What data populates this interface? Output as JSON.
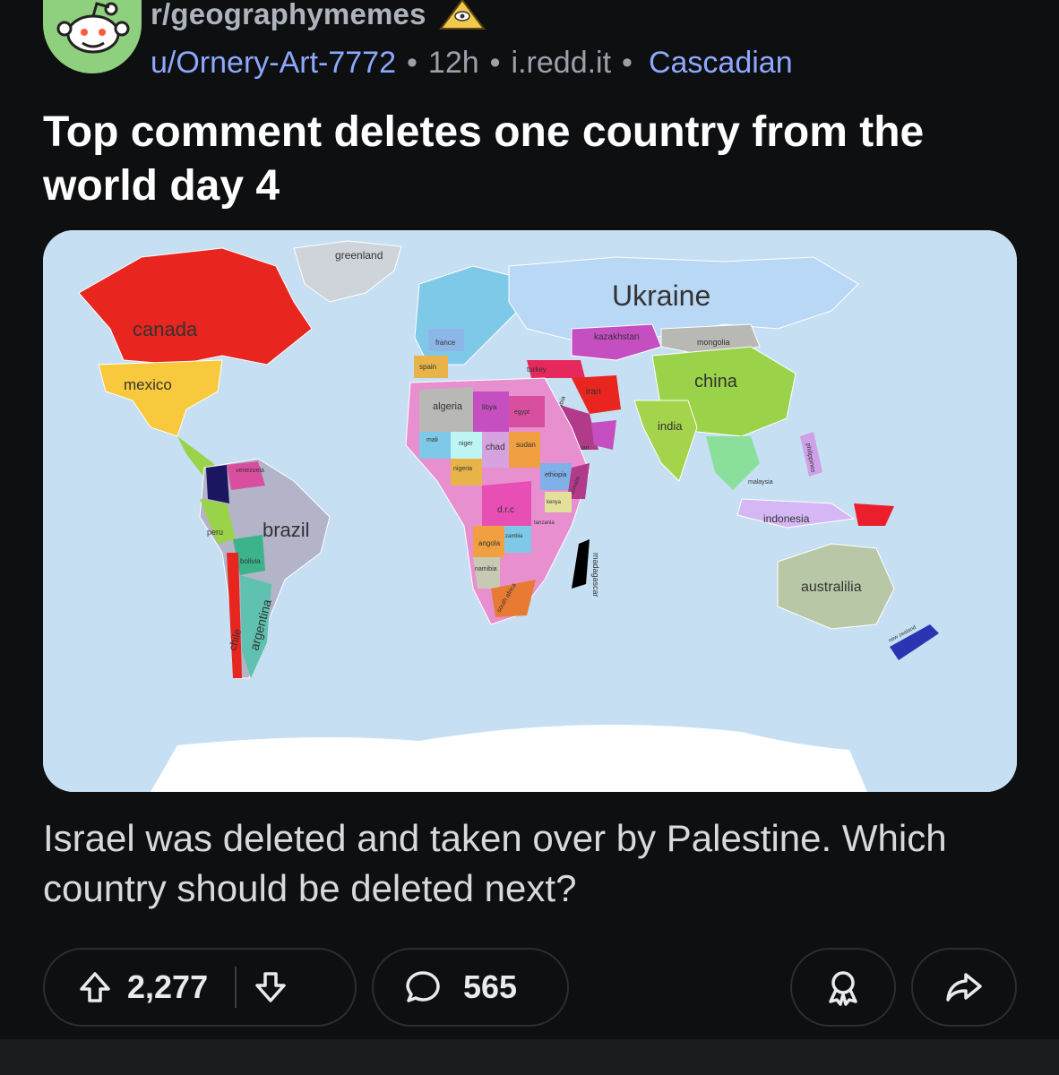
{
  "post": {
    "subreddit": "r/geographymemes",
    "author": "u/Ornery-Art-7772",
    "age": "12h",
    "domain": "i.redd.it",
    "flair": "Cascadian",
    "title": "Top comment deletes one country from the world day 4",
    "body": "Israel was deleted and taken over by Palestine. Which country should be deleted next?"
  },
  "map": {
    "labels": {
      "greenland": "greenland",
      "ukraine": "Ukraine",
      "canada": "canada",
      "mexico": "mexico",
      "kazakhstan": "kazakhstan",
      "mongolia": "mongolia",
      "china": "china",
      "france": "france",
      "spain": "spain",
      "turkey": "turkey",
      "iran": "iran",
      "algeria": "algeria",
      "libya": "libya",
      "egypt": "egypt",
      "saudi_arabia": "saudi arabia",
      "oman": "oman",
      "india": "india",
      "mali": "mali",
      "niger": "niger",
      "chad": "chad",
      "sudan": "sudan",
      "nigeria": "nigeria",
      "ethiopia": "ethiopia",
      "somalia": "somalia",
      "kenya": "kenya",
      "drc": "d.r.c",
      "tanzania": "tanzania",
      "angola": "angola",
      "zambia": "zambia",
      "namibia": "namibia",
      "south_africa": "south africa",
      "madagascar": "madagascar",
      "brazil": "brazil",
      "peru": "peru",
      "bolivia": "bolivia",
      "chile": "chile",
      "argentina": "argentina",
      "venezuela": "venezuela",
      "malaysia": "malaysia",
      "indonesia": "indonesia",
      "philippines": "philippines",
      "australia": "australilia",
      "new_zealand": "new zealand"
    }
  },
  "actions": {
    "upvotes": "2,277",
    "comments": "565"
  },
  "colors": {
    "background": "#0e0f11",
    "link": "#8ea8ff",
    "ocean": "#c7dff2"
  }
}
